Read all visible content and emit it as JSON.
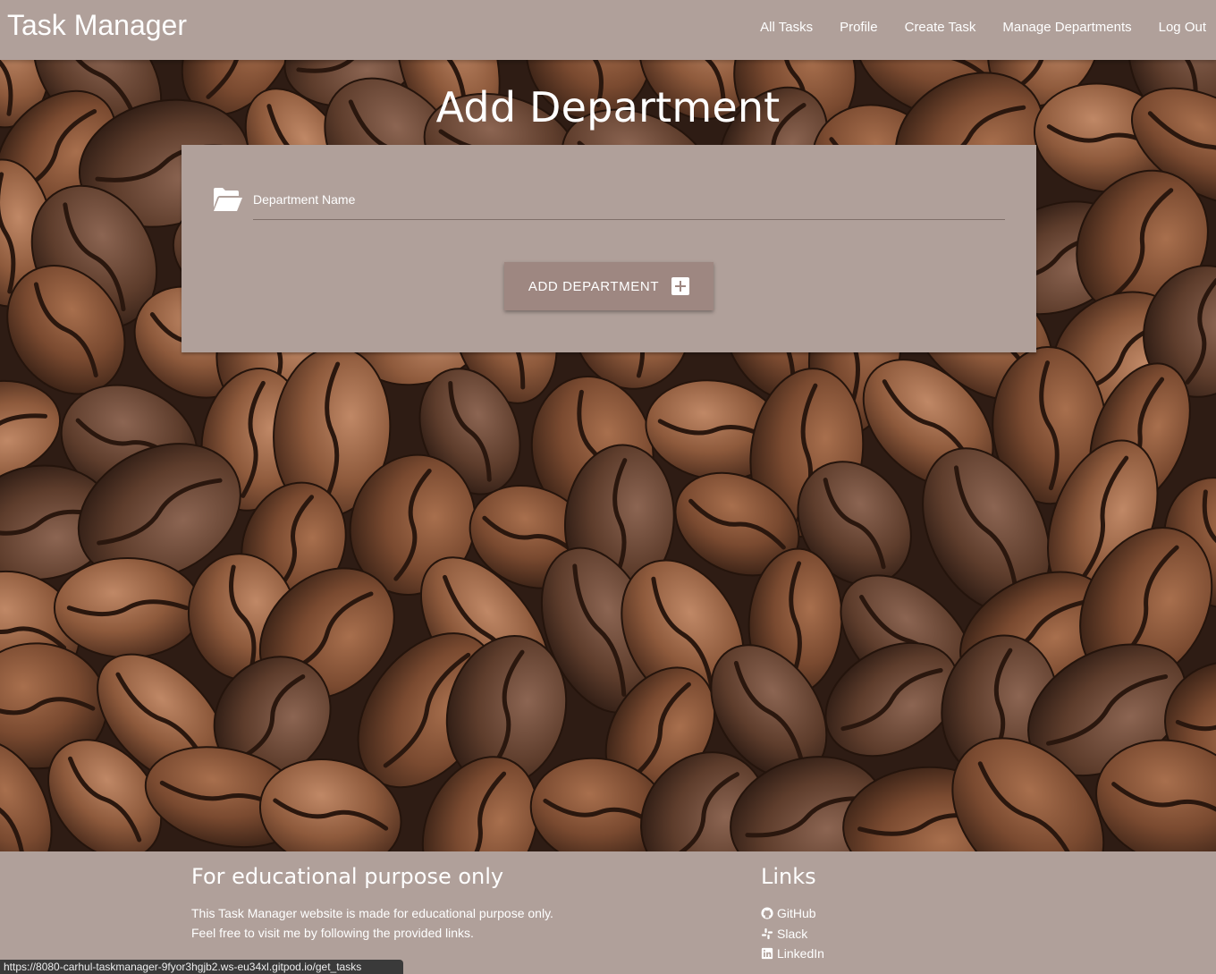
{
  "nav": {
    "brand": "Task Manager",
    "links": [
      "All Tasks",
      "Profile",
      "Create Task",
      "Manage Departments",
      "Log Out"
    ]
  },
  "page": {
    "title": "Add Department"
  },
  "form": {
    "field_label": "Department Name",
    "field_icon": "folder-open-icon",
    "submit_label": "ADD DEPARTMENT",
    "submit_icon": "plus-square-icon"
  },
  "footer": {
    "left_title": "For educational purpose only",
    "left_line1": "This Task Manager website is made for educational purpose only.",
    "left_line2": "Feel free to visit me by following the provided links.",
    "right_title": "Links",
    "links": [
      {
        "label": "GitHub",
        "icon": "github-icon"
      },
      {
        "label": "Slack",
        "icon": "slack-icon"
      },
      {
        "label": "LinkedIn",
        "icon": "linkedin-icon"
      }
    ]
  },
  "status_bar": {
    "url": "https://8080-carhul-taskmanager-9fyor3hgjb2.ws-eu34xl.gitpod.io/get_tasks"
  },
  "colors": {
    "surface": "#b0a09a",
    "button": "#9e8781",
    "background_image": "coffee beans"
  }
}
